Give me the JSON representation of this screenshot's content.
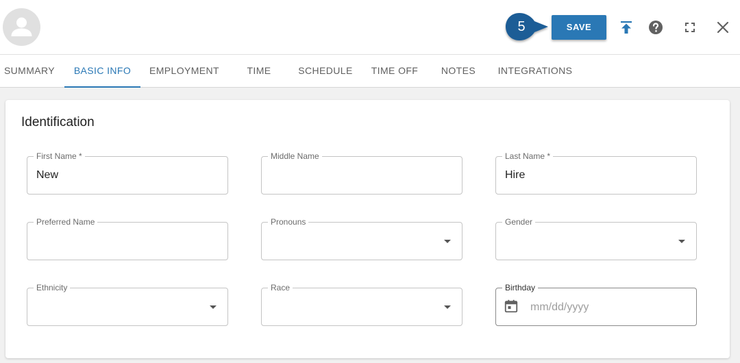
{
  "header": {
    "step_number": "5",
    "save_label": "SAVE",
    "avatar_icon": "person-icon",
    "icons": [
      "upload-icon",
      "help-icon",
      "fullscreen-icon",
      "close-icon"
    ],
    "accent_color": "#2a78b5"
  },
  "tabs": [
    {
      "label": "SUMMARY",
      "active": false
    },
    {
      "label": "BASIC INFO",
      "active": true
    },
    {
      "label": "EMPLOYMENT",
      "active": false
    },
    {
      "label": "TIME",
      "active": false
    },
    {
      "label": "SCHEDULE",
      "active": false
    },
    {
      "label": "TIME OFF",
      "active": false
    },
    {
      "label": "NOTES",
      "active": false
    },
    {
      "label": "INTEGRATIONS",
      "active": false
    }
  ],
  "identification": {
    "title": "Identification",
    "first_name": {
      "label": "First Name *",
      "value": "New"
    },
    "middle_name": {
      "label": "Middle Name",
      "value": ""
    },
    "last_name": {
      "label": "Last Name *",
      "value": "Hire"
    },
    "preferred_name": {
      "label": "Preferred Name",
      "value": ""
    },
    "pronouns": {
      "label": "Pronouns",
      "value": ""
    },
    "gender": {
      "label": "Gender",
      "value": ""
    },
    "ethnicity": {
      "label": "Ethnicity",
      "value": ""
    },
    "race": {
      "label": "Race",
      "value": ""
    },
    "birthday": {
      "label": "Birthday",
      "placeholder": "mm/dd/yyyy",
      "icon": "calendar-icon"
    }
  }
}
